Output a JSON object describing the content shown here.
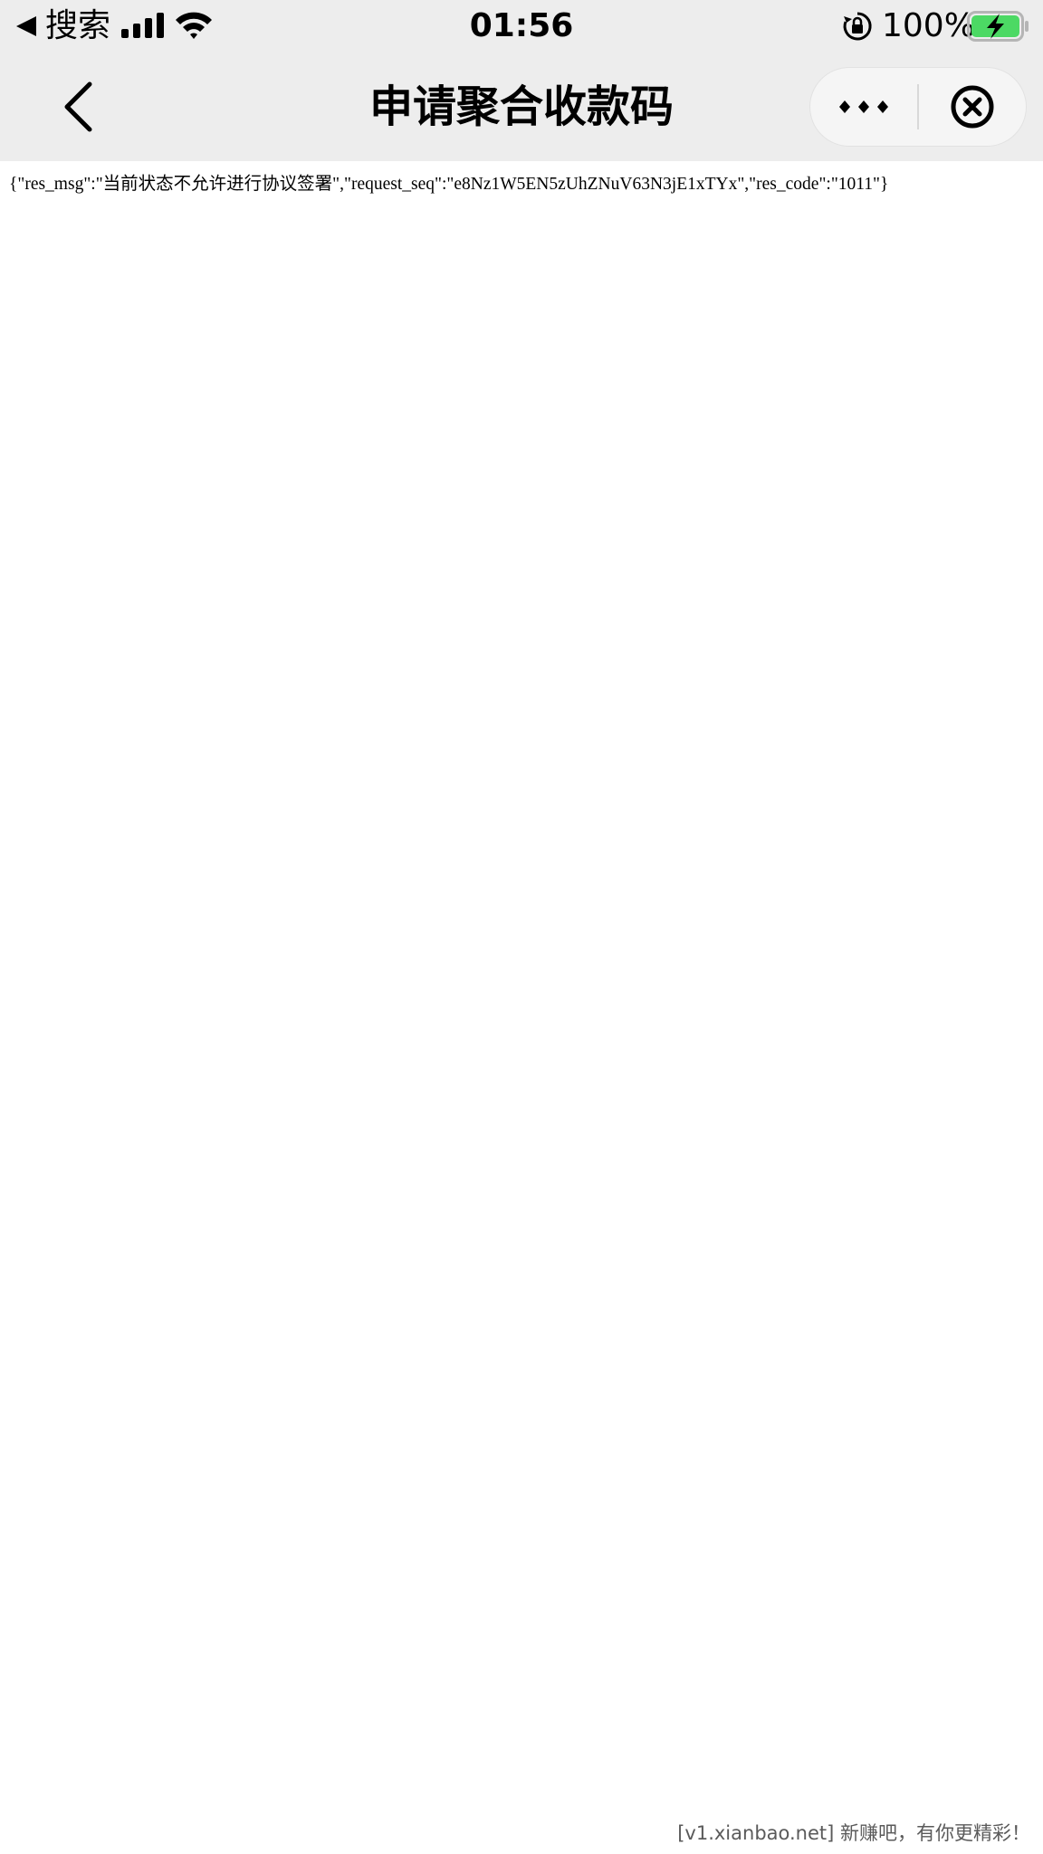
{
  "status_bar": {
    "back_app_label": "搜索",
    "time": "01:56",
    "battery_percent": "100%",
    "battery_level": 1.0,
    "icons": [
      "back-triangle-icon",
      "signal-icon",
      "wifi-icon",
      "rotation-lock-icon",
      "battery-charging-icon"
    ]
  },
  "nav_bar": {
    "title": "申请聚合收款码",
    "icons": [
      "chevron-left-icon",
      "more-dots-icon",
      "close-circle-icon"
    ]
  },
  "content": {
    "response_text": "{\"res_msg\":\"当前状态不允许进行协议签署\",\"request_seq\":\"e8Nz1W5EN5zUhZNuV63N3jE1xTYx\",\"res_code\":\"1011\"}"
  },
  "watermark": {
    "text": "[v1.xianbao.net] 新赚吧，有你更精彩！"
  },
  "colors": {
    "chrome_background": "#ededed",
    "content_background": "#ffffff",
    "battery_green": "#4cd964",
    "watermark_gray": "#5a5a5a"
  }
}
